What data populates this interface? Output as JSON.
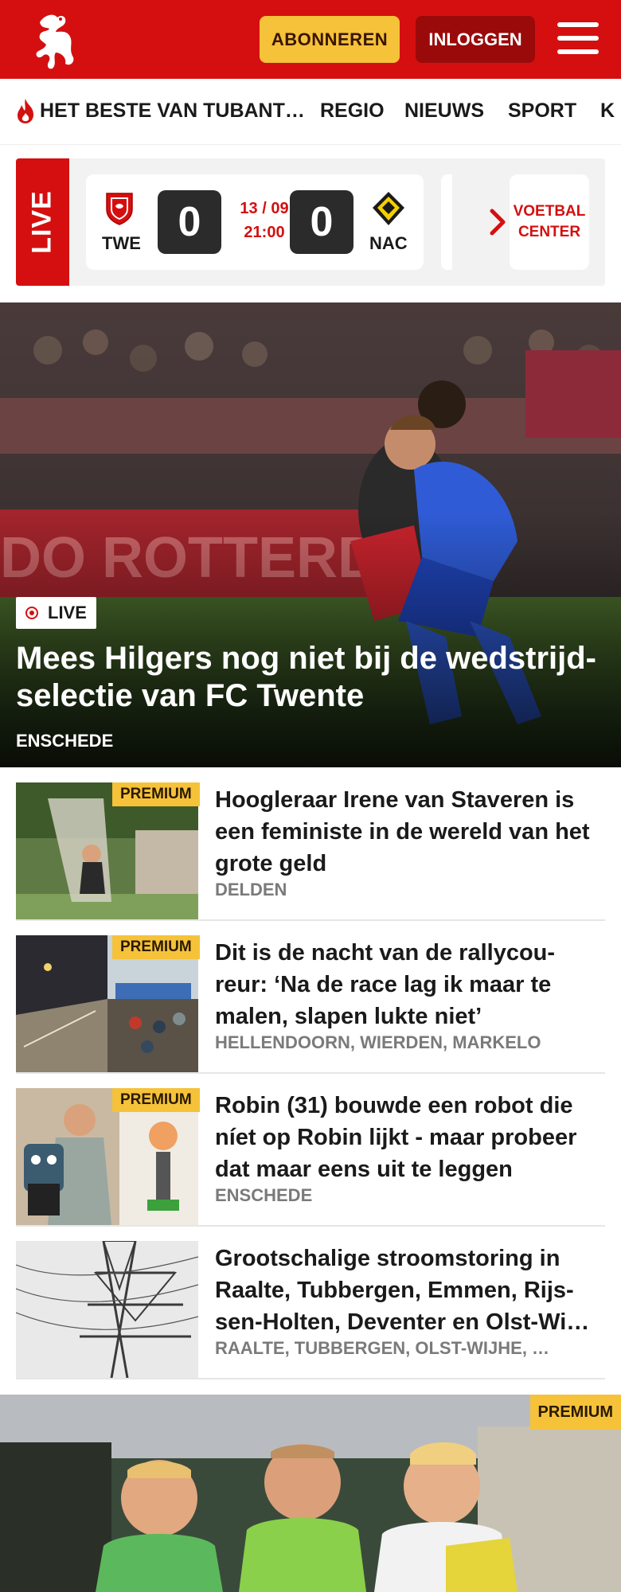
{
  "header": {
    "subscribe_label": "ABONNEREN",
    "login_label": "INLOGGEN",
    "brand_color": "#d50f0f",
    "subscribe_color": "#f5c23a"
  },
  "nav": {
    "items": [
      {
        "label": "HET BESTE VAN TUBANT…",
        "icon": "flame-icon"
      },
      {
        "label": "REGIO"
      },
      {
        "label": "NIEUWS"
      },
      {
        "label": "SPORT"
      },
      {
        "label": "K"
      }
    ]
  },
  "live_widget": {
    "tab_label": "LIVE",
    "home": {
      "code": "TWE",
      "score": "0"
    },
    "away": {
      "code": "NAC",
      "score": "0"
    },
    "date": "13 / 09",
    "time": "21:00",
    "center_label_1": "VOETBAL",
    "center_label_2": "CENTER"
  },
  "hero": {
    "badge": "LIVE",
    "title": "Mees Hilgers nog niet bij de wedstrijd-selectie van FC Twente",
    "place": "ENSCHEDE"
  },
  "articles": [
    {
      "premium": "PREMIUM",
      "title": "Hoogleraar Irene van Staveren is een feministe in de wereld van het grote geld",
      "place": "DELDEN"
    },
    {
      "premium": "PREMIUM",
      "title": "Dit is de nacht van de rallycou-reur: ‘Na de race lag ik maar te malen, slapen lukte niet’",
      "place": "HELLENDOORN, WIERDEN, MARKELO"
    },
    {
      "premium": "PREMIUM",
      "title": "Robin (31) bouwde een robot die níet op Robin lijkt - maar probeer dat maar eens uit te leggen",
      "place": "ENSCHEDE"
    },
    {
      "premium": "",
      "title": "Grootschalige stroomstoring in Raalte, Tubbergen, Emmen, Rijs-sen-Holten, Deventer en Olst-Wi…",
      "place": "RAALTE, TUBBERGEN, OLST-WIJHE, …"
    }
  ],
  "bottom_feature": {
    "premium": "PREMIUM"
  }
}
